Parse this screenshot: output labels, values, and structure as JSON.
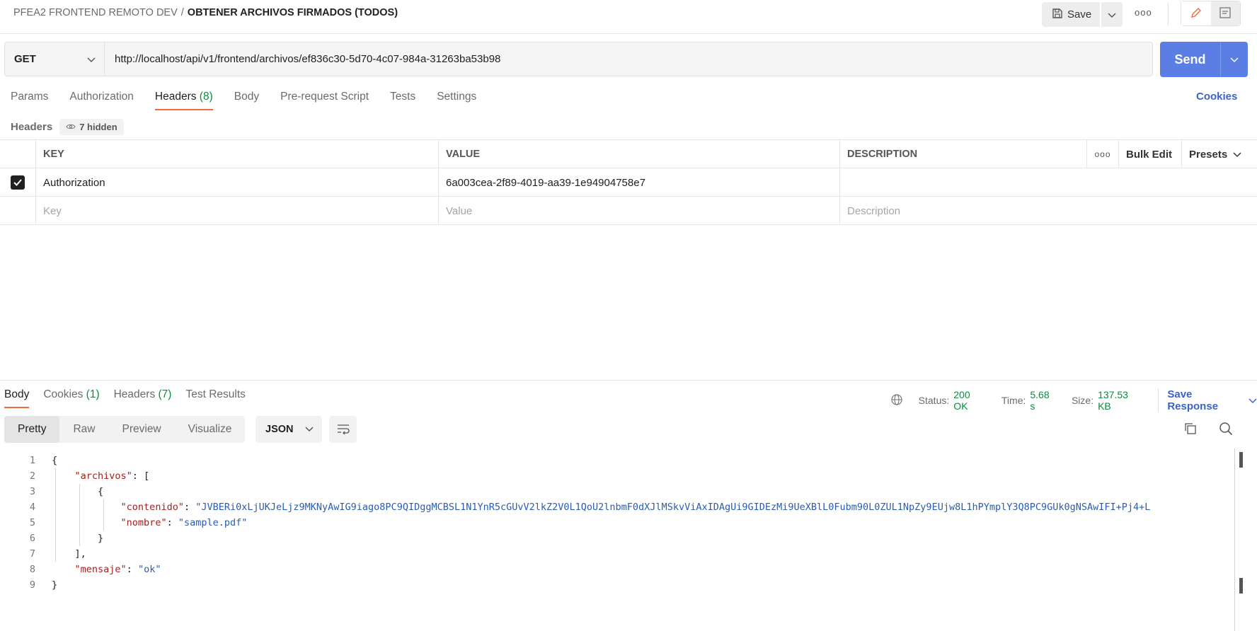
{
  "header": {
    "collection": "PFEA2 FRONTEND REMOTO DEV",
    "separator": "/",
    "request_name": "OBTENER ARCHIVOS FIRMADOS (TODOS)",
    "save_label": "Save",
    "more_label": "ooo"
  },
  "request": {
    "method": "GET",
    "url": "http://localhost/api/v1/frontend/archivos/ef836c30-5d70-4c07-984a-31263ba53b98",
    "send_label": "Send"
  },
  "request_tabs": [
    {
      "label": "Params",
      "count": ""
    },
    {
      "label": "Authorization",
      "count": ""
    },
    {
      "label": "Headers",
      "count": "(8)"
    },
    {
      "label": "Body",
      "count": ""
    },
    {
      "label": "Pre-request Script",
      "count": ""
    },
    {
      "label": "Tests",
      "count": ""
    },
    {
      "label": "Settings",
      "count": ""
    }
  ],
  "cookies_link": "Cookies",
  "headers_section": {
    "label": "Headers",
    "hidden_label": "7 hidden",
    "columns": {
      "key": "KEY",
      "value": "VALUE",
      "description": "DESCRIPTION",
      "more": "ooo",
      "bulk_edit": "Bulk Edit",
      "presets": "Presets"
    },
    "rows": [
      {
        "checked": true,
        "key": "Authorization",
        "value": "6a003cea-2f89-4019-aa39-1e94904758e7",
        "description": ""
      }
    ],
    "placeholders": {
      "key": "Key",
      "value": "Value",
      "description": "Description"
    }
  },
  "response_tabs": [
    {
      "label": "Body",
      "count": ""
    },
    {
      "label": "Cookies",
      "count": "(1)"
    },
    {
      "label": "Headers",
      "count": "(7)"
    },
    {
      "label": "Test Results",
      "count": ""
    }
  ],
  "response_meta": {
    "status_label": "Status:",
    "status_value": "200 OK",
    "time_label": "Time:",
    "time_value": "5.68 s",
    "size_label": "Size:",
    "size_value": "137.53 KB",
    "save_response": "Save Response"
  },
  "view_tabs": [
    "Pretty",
    "Raw",
    "Preview",
    "Visualize"
  ],
  "format": "JSON",
  "code_lines": [
    {
      "n": "1",
      "parts": [
        [
          "p",
          "{"
        ]
      ]
    },
    {
      "n": "2",
      "parts": [
        [
          "p",
          "    "
        ],
        [
          "k",
          "\"archivos\""
        ],
        [
          "p",
          ": ["
        ]
      ]
    },
    {
      "n": "3",
      "parts": [
        [
          "p",
          "        {"
        ]
      ]
    },
    {
      "n": "4",
      "parts": [
        [
          "p",
          "            "
        ],
        [
          "k",
          "\"contenido\""
        ],
        [
          "p",
          ": "
        ],
        [
          "s",
          "\"JVBERi0xLjUKJeLjz9MKNyAwIG9iago8PC9QIDggMCBSL1N1YnR5cGUvV2lkZ2V0L1QoU2lnbmF0dXJlMSkvViAxIDAgUi9GIDEzMi9UeXBlL0Fubm90L0ZUL1NpZy9EUjw8L1hPYmplY3Q8PC9GUk0gNSAwIFI+Pj4+L"
        ]
      ]
    },
    {
      "n": "5",
      "parts": [
        [
          "p",
          "            "
        ],
        [
          "k",
          "\"nombre\""
        ],
        [
          "p",
          ": "
        ],
        [
          "s",
          "\"sample.pdf\""
        ]
      ]
    },
    {
      "n": "6",
      "parts": [
        [
          "p",
          "        }"
        ]
      ]
    },
    {
      "n": "7",
      "parts": [
        [
          "p",
          "    ],"
        ]
      ]
    },
    {
      "n": "8",
      "parts": [
        [
          "p",
          "    "
        ],
        [
          "k",
          "\"mensaje\""
        ],
        [
          "p",
          ": "
        ],
        [
          "s",
          "\"ok\""
        ]
      ]
    },
    {
      "n": "9",
      "parts": [
        [
          "p",
          "}"
        ]
      ]
    }
  ],
  "colors": {
    "accent": "#f26b3a",
    "send": "#5b7ee5",
    "link": "#3d62c9",
    "ok": "#0c8a3e",
    "json_key": "#a12222",
    "json_string": "#2a5db0"
  },
  "icons": [
    "save-icon",
    "chevron-down-icon",
    "more-icon",
    "edit-icon",
    "comment-icon",
    "eye-icon",
    "check-icon",
    "globe-icon",
    "wrap-lines-icon",
    "copy-icon",
    "search-icon"
  ]
}
